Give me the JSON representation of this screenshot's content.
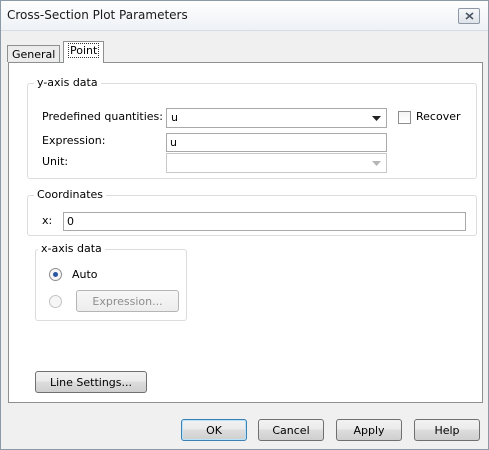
{
  "window": {
    "title": "Cross-Section Plot Parameters"
  },
  "tabs": [
    {
      "label": "General",
      "active": false
    },
    {
      "label": "Point",
      "active": true
    }
  ],
  "y_axis_group": {
    "title": "y-axis data",
    "predefined_label": "Predefined quantities:",
    "predefined_value": "u",
    "recover_label": "Recover",
    "recover_checked": false,
    "expression_label": "Expression:",
    "expression_value": "u",
    "unit_label": "Unit:",
    "unit_value": ""
  },
  "coordinates_group": {
    "title": "Coordinates",
    "x_label": "x:",
    "x_value": "0"
  },
  "x_axis_group": {
    "title": "x-axis data",
    "auto_label": "Auto",
    "auto_selected": true,
    "expression_button": "Expression..."
  },
  "line_settings_button": "Line Settings...",
  "footer": {
    "ok": "OK",
    "cancel": "Cancel",
    "apply": "Apply",
    "help": "Help"
  },
  "icons": {
    "close": "close-icon",
    "dropdown": "chevron-down-icon"
  },
  "colors": {
    "dialog_bg": "#f0f0f0",
    "panel_bg": "#ffffff",
    "radio_selected": "#2a55a0"
  }
}
